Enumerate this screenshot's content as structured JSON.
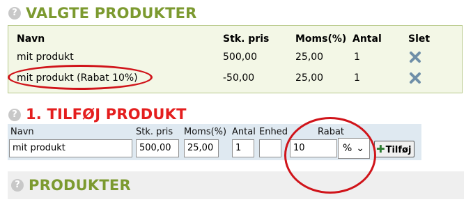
{
  "selected_section": {
    "help_glyph": "?",
    "title": "VALGTE PRODUKTER",
    "columns": {
      "name": "Navn",
      "unit_price": "Stk. pris",
      "vat": "Moms(%)",
      "qty": "Antal",
      "delete": "Slet"
    },
    "rows": [
      {
        "name": "mit produkt",
        "unit_price": "500,00",
        "vat": "25,00",
        "qty": "1"
      },
      {
        "name": "mit produkt (Rabat 10%)",
        "unit_price": "-50,00",
        "vat": "25,00",
        "qty": "1"
      }
    ]
  },
  "add_section": {
    "help_glyph": "?",
    "title": "1. TILFØJ PRODUKT",
    "labels": {
      "name": "Navn",
      "unit_price": "Stk. pris",
      "vat": "Moms(%)",
      "qty": "Antal",
      "unit": "Enhed",
      "discount": "Rabat"
    },
    "values": {
      "name": "mit produkt",
      "unit_price": "500,00",
      "vat": "25,00",
      "qty": "1",
      "unit": "",
      "discount": "10",
      "discount_type": "%"
    },
    "add_button": "Tilføj"
  },
  "products_section": {
    "help_glyph": "?",
    "title": "PRODUKTER"
  },
  "colors": {
    "section_green": "#7c9a30",
    "section_red": "#e41e1e",
    "annotation_red": "#d0141a",
    "delete_icon": "#6f8fa8"
  }
}
